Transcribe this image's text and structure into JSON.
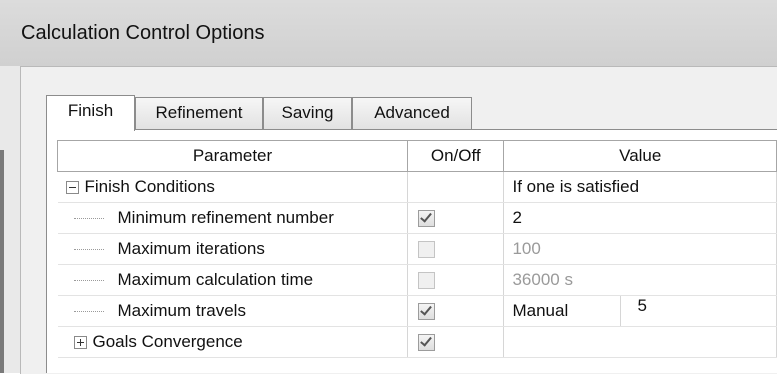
{
  "window": {
    "title": "Calculation Control Options"
  },
  "tabs": [
    {
      "label": "Finish",
      "active": true
    },
    {
      "label": "Refinement",
      "active": false
    },
    {
      "label": "Saving",
      "active": false
    },
    {
      "label": "Advanced",
      "active": false
    }
  ],
  "table": {
    "headers": {
      "parameter": "Parameter",
      "onoff": "On/Off",
      "value": "Value"
    },
    "rows": {
      "finish_conditions": {
        "label": "Finish Conditions",
        "value": "If one is satisfied",
        "expander": "minus"
      },
      "min_refinement": {
        "label": "Minimum refinement number",
        "checked": true,
        "value": "2"
      },
      "max_iterations": {
        "label": "Maximum iterations",
        "checked": false,
        "value": "100"
      },
      "max_calc_time": {
        "label": "Maximum calculation time",
        "checked": false,
        "value": "36000 s"
      },
      "max_travels": {
        "label": "Maximum travels",
        "checked": true,
        "mode": "Manual",
        "value": "5"
      },
      "goals_convergence": {
        "label": "Goals Convergence",
        "checked": true,
        "expander": "plus"
      }
    }
  },
  "colors": {
    "title_bar": "#d4d4d4",
    "disabled_text": "#9a9a9a"
  }
}
